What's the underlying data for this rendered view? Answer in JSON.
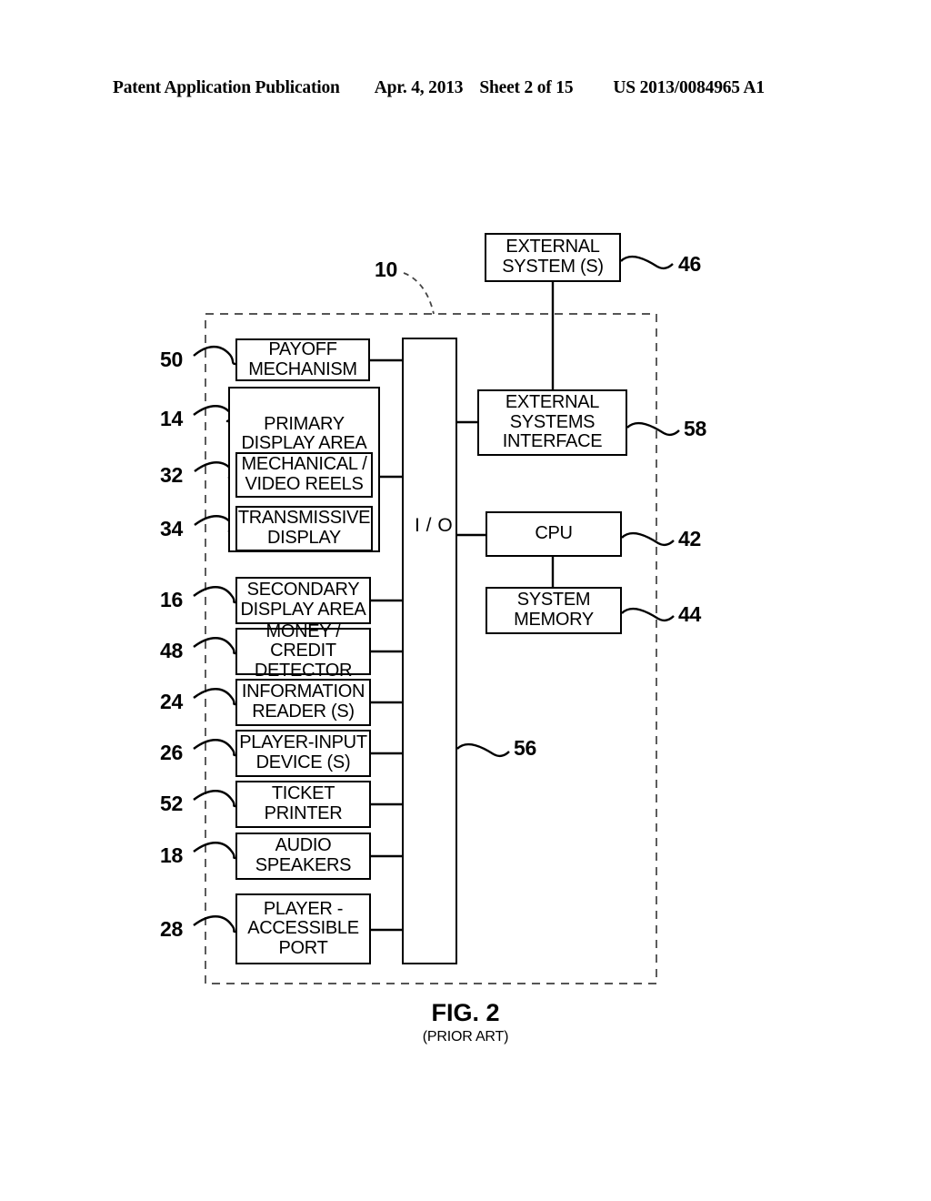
{
  "header": {
    "publication": "Patent Application Publication",
    "date": "Apr. 4, 2013",
    "sheet": "Sheet 2 of 15",
    "number": "US 2013/0084965 A1"
  },
  "caption": {
    "title": "FIG. 2",
    "subtitle": "(PRIOR ART)"
  },
  "diagram": {
    "machine_ref": "10",
    "io_label": "I / O",
    "io_ref": "56",
    "external_system": {
      "label": "EXTERNAL\nSYSTEM (S)",
      "ref": "46"
    },
    "left_column": [
      {
        "label": "PAYOFF\nMECHANISM",
        "ref": "50"
      },
      {
        "label": "PRIMARY\nDISPLAY AREA",
        "ref": "14"
      },
      {
        "label": "MECHANICAL /\nVIDEO REELS",
        "ref": "32"
      },
      {
        "label": "TRANSMISSIVE\nDISPLAY",
        "ref": "34"
      },
      {
        "label": "SECONDARY\nDISPLAY AREA",
        "ref": "16"
      },
      {
        "label": "MONEY / CREDIT\nDETECTOR",
        "ref": "48"
      },
      {
        "label": "INFORMATION\nREADER (S)",
        "ref": "24"
      },
      {
        "label": "PLAYER-INPUT\nDEVICE (S)",
        "ref": "26"
      },
      {
        "label": "TICKET PRINTER",
        "ref": "52"
      },
      {
        "label": "AUDIO\nSPEAKERS",
        "ref": "18"
      },
      {
        "label": "PLAYER -\nACCESSIBLE\nPORT",
        "ref": "28"
      }
    ],
    "right_column": [
      {
        "label": "EXTERNAL\nSYSTEMS\nINTERFACE",
        "ref": "58"
      },
      {
        "label": "CPU",
        "ref": "42"
      },
      {
        "label": "SYSTEM\nMEMORY",
        "ref": "44"
      }
    ]
  }
}
